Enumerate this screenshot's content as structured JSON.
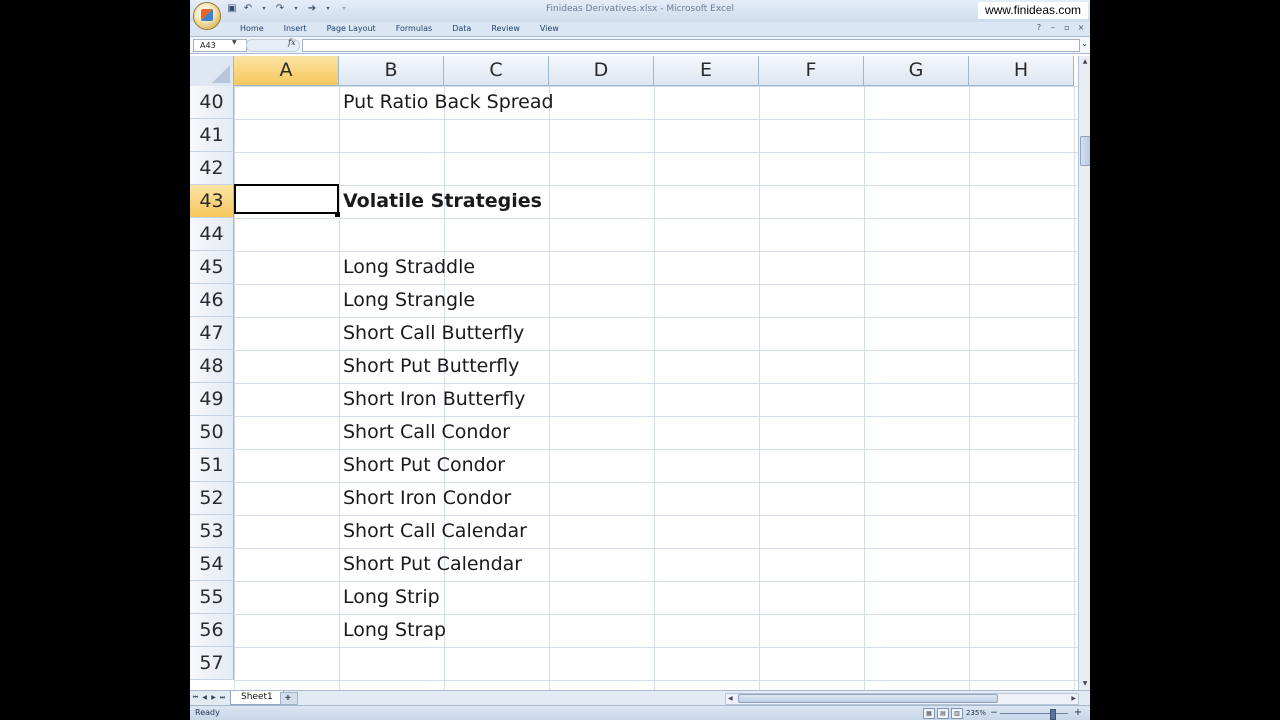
{
  "window": {
    "title": "Finideas Derivatives.xlsx - Microsoft Excel",
    "watermark": "www.finideas.com"
  },
  "ribbon": {
    "tabs": [
      "Home",
      "Insert",
      "Page Layout",
      "Formulas",
      "Data",
      "Review",
      "View"
    ]
  },
  "formula_bar": {
    "name_box": "A43",
    "fx_label": "fx",
    "formula": ""
  },
  "grid": {
    "columns": [
      "A",
      "B",
      "C",
      "D",
      "E",
      "F",
      "G",
      "H"
    ],
    "selected_column": "A",
    "rows": [
      {
        "num": "40",
        "b": "Put Ratio Back Spread",
        "bold": false
      },
      {
        "num": "41",
        "b": "",
        "bold": false
      },
      {
        "num": "42",
        "b": "",
        "bold": false
      },
      {
        "num": "43",
        "b": "Volatile Strategies",
        "bold": true,
        "selected": true
      },
      {
        "num": "44",
        "b": "",
        "bold": false
      },
      {
        "num": "45",
        "b": "Long Straddle",
        "bold": false
      },
      {
        "num": "46",
        "b": "Long Strangle",
        "bold": false
      },
      {
        "num": "47",
        "b": "Short Call Butterfly",
        "bold": false
      },
      {
        "num": "48",
        "b": "Short Put Butterfly",
        "bold": false
      },
      {
        "num": "49",
        "b": "Short Iron Butterfly",
        "bold": false
      },
      {
        "num": "50",
        "b": "Short Call Condor",
        "bold": false
      },
      {
        "num": "51",
        "b": "Short Put Condor",
        "bold": false
      },
      {
        "num": "52",
        "b": "Short Iron Condor",
        "bold": false
      },
      {
        "num": "53",
        "b": "Short Call Calendar",
        "bold": false
      },
      {
        "num": "54",
        "b": "Short Put Calendar",
        "bold": false
      },
      {
        "num": "55",
        "b": "Long Strip",
        "bold": false
      },
      {
        "num": "56",
        "b": "Long Strap",
        "bold": false
      },
      {
        "num": "57",
        "b": "",
        "bold": false
      }
    ]
  },
  "sheets": {
    "tabs": [
      "Sheet1"
    ]
  },
  "status": {
    "text": "Ready",
    "zoom": "235%"
  },
  "colors": {
    "selected_header": "#f6c75c",
    "grid_line": "#d4dde8"
  }
}
